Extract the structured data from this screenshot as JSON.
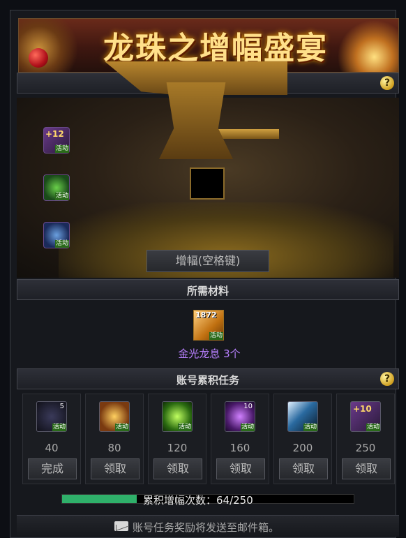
{
  "banner": {
    "title": "龙珠之增幅盛宴"
  },
  "top_bar": {
    "help": "?"
  },
  "scene": {
    "side_items": [
      {
        "name": "plus-12-icon",
        "text": "+12",
        "badge": "活动"
      },
      {
        "name": "green-lock-orb-icon",
        "badge": "活动"
      },
      {
        "name": "blue-lock-orb-icon",
        "badge": "活动"
      }
    ],
    "amplify_button": "增幅(空格键)"
  },
  "materials": {
    "title": "所需材料",
    "item": {
      "count": "1872",
      "badge": "活动",
      "name": "金光龙息 3个"
    }
  },
  "tasks": {
    "title": "账号累积任务",
    "help": "?",
    "items": [
      {
        "icon": "gold-check-icon",
        "icon_text": "5",
        "badge": "活动",
        "threshold": "40",
        "button": "完成"
      },
      {
        "icon": "gold-seal-icon",
        "icon_text": "",
        "badge": "活动",
        "threshold": "80",
        "button": "领取"
      },
      {
        "icon": "green-orb-icon",
        "icon_text": "",
        "badge": "活动",
        "threshold": "120",
        "button": "领取"
      },
      {
        "icon": "purple-orb-icon",
        "icon_text": "10",
        "badge": "活动",
        "threshold": "160",
        "button": "领取"
      },
      {
        "icon": "hammer-icon",
        "icon_text": "",
        "badge": "活动",
        "threshold": "200",
        "button": "领取"
      },
      {
        "icon": "plus-10-icon",
        "icon_text": "+10",
        "badge": "活动",
        "threshold": "250",
        "button": "领取"
      }
    ],
    "progress": {
      "label": "累积增幅次数：64/250",
      "current": 64,
      "max": 250
    }
  },
  "footer": {
    "text": "账号任务奖励将发送至邮件箱。"
  },
  "colors": {
    "progress": "#2fb06a",
    "material_name": "#b880ff",
    "banner_title": "#ffe08a"
  }
}
